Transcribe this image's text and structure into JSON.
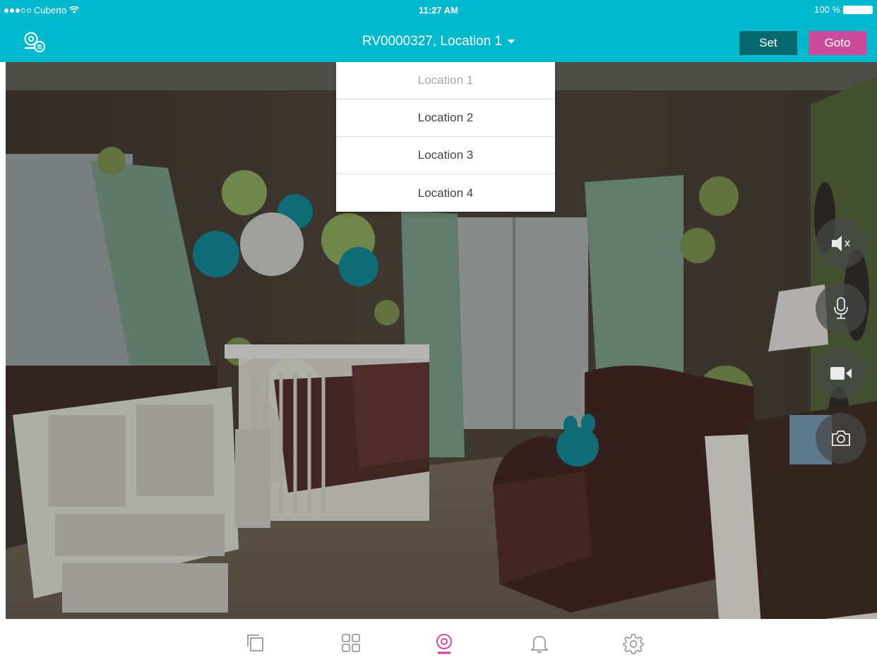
{
  "status_bar": {
    "carrier": "Cuberto",
    "time": "11:27 AM",
    "battery": "100 %"
  },
  "nav": {
    "title": "RV0000327, Location 1",
    "set_label": "Set",
    "goto_label": "Goto",
    "device_icon": "camera-device-icon"
  },
  "locations": {
    "items": [
      "Location 1",
      "Location 2",
      "Location 3",
      "Location 4"
    ],
    "selected": "Location 1"
  },
  "controls": [
    "speaker-mute-icon",
    "microphone-icon",
    "video-record-icon",
    "camera-snapshot-icon"
  ],
  "tabs": [
    {
      "icon": "copy-icon",
      "active": false
    },
    {
      "icon": "grid-icon",
      "active": false
    },
    {
      "icon": "camera-icon",
      "active": true
    },
    {
      "icon": "bell-icon",
      "active": false
    },
    {
      "icon": "gear-icon",
      "active": false
    }
  ],
  "colors": {
    "header": "#00b9cc",
    "set_button": "#05696f",
    "goto_button": "#cc4a9b",
    "active_tab": "#d4399a",
    "inactive_tab": "#8a8a8a"
  }
}
